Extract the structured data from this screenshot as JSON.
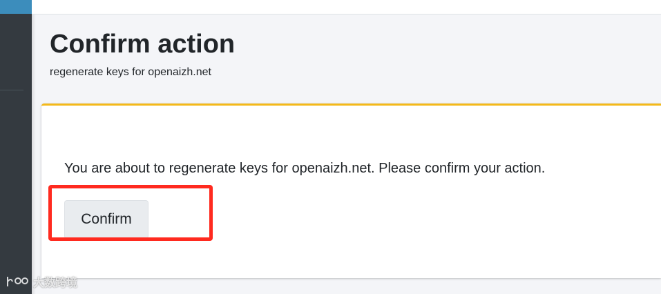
{
  "header": {
    "title": "Confirm action",
    "subtitle": "regenerate keys for openaizh.net"
  },
  "card": {
    "accent_color": "#f4b91a",
    "message": "You are about to regenerate keys for openaizh.net. Please confirm your action.",
    "confirm_label": "Confirm"
  },
  "annotation": {
    "highlight_color": "#ff2a1f",
    "target": "confirm-button"
  },
  "watermark": {
    "text": "大数跨境"
  }
}
